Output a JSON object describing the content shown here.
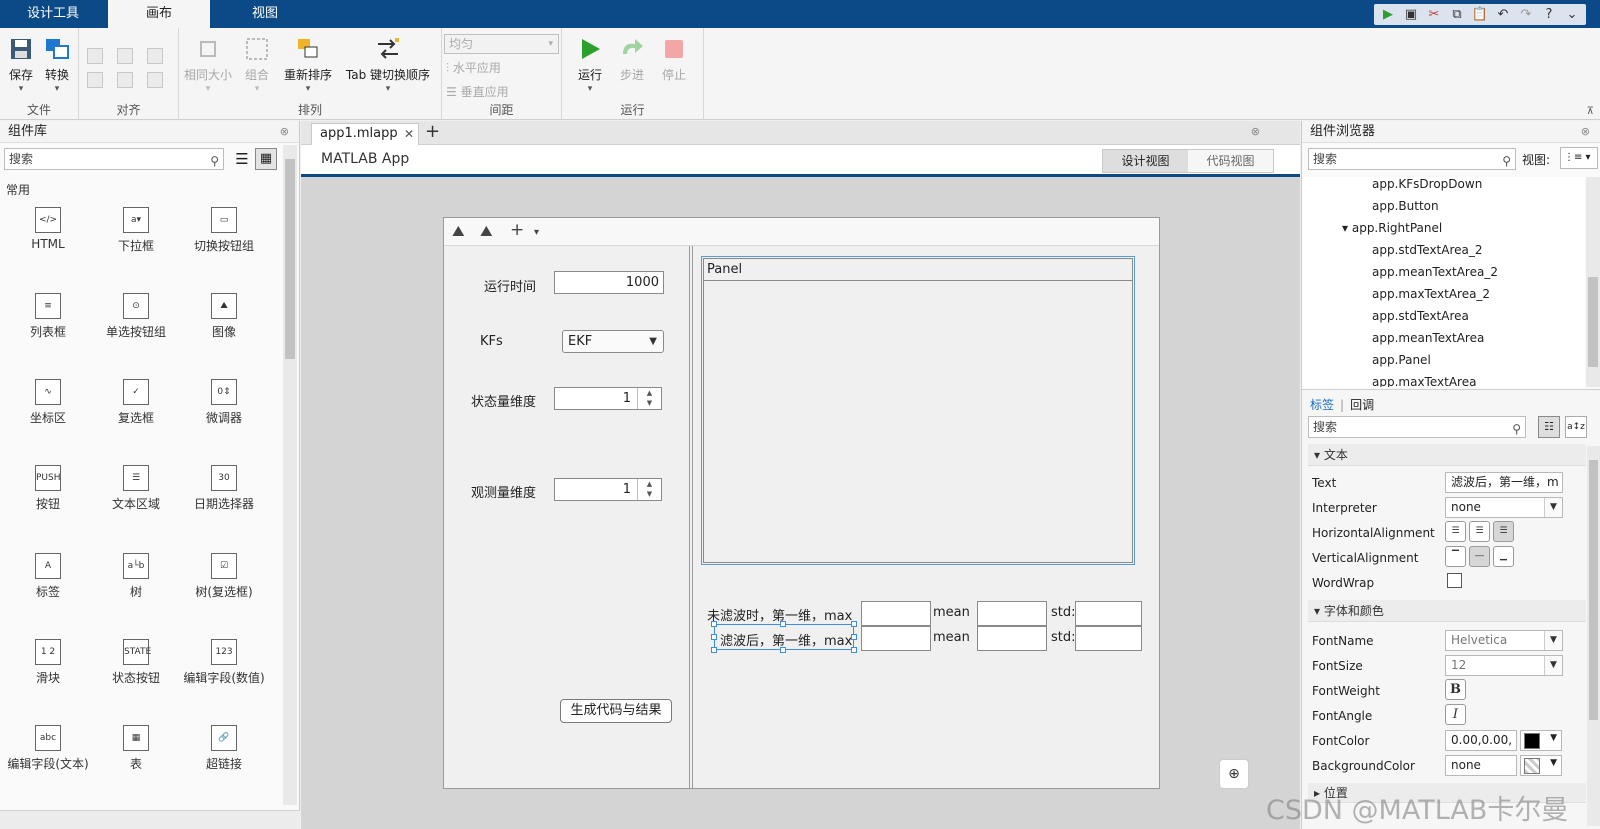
{
  "tabs": [
    {
      "label": "设计工具"
    },
    {
      "label": "画布"
    },
    {
      "label": "视图"
    }
  ],
  "ribbon": {
    "file": {
      "title": "文件",
      "save": "保存",
      "convert": "转换"
    },
    "align": {
      "title": "对齐"
    },
    "arrange": {
      "title": "排列",
      "same_size": "相同大小",
      "group": "组合",
      "reorder": "重新排序",
      "tab_order": "Tab 键切换顺序"
    },
    "spacing": {
      "title": "间距",
      "even": "均匀",
      "horiz": "水平应用",
      "vert": "垂直应用"
    },
    "run": {
      "title": "运行",
      "run": "运行",
      "step": "步进",
      "stop": "停止"
    }
  },
  "library": {
    "title": "组件库",
    "search_placeholder": "搜索",
    "section": "常用",
    "components": [
      {
        "label": "HTML",
        "icon": "html-icon",
        "glyph": "</>"
      },
      {
        "label": "下拉框",
        "icon": "dropdown-icon",
        "glyph": "a▾"
      },
      {
        "label": "切换按钮组",
        "icon": "toggle-button-group-icon",
        "glyph": "▭"
      },
      {
        "label": "列表框",
        "icon": "listbox-icon",
        "glyph": "≡"
      },
      {
        "label": "单选按钮组",
        "icon": "radio-group-icon",
        "glyph": "⊙"
      },
      {
        "label": "图像",
        "icon": "image-icon",
        "glyph": "⛰"
      },
      {
        "label": "坐标区",
        "icon": "axes-icon",
        "glyph": "∿"
      },
      {
        "label": "复选框",
        "icon": "checkbox-icon",
        "glyph": "✓"
      },
      {
        "label": "微调器",
        "icon": "spinner-icon",
        "glyph": "0⇕"
      },
      {
        "label": "按钮",
        "icon": "push-button-icon",
        "glyph": "PUSH"
      },
      {
        "label": "文本区域",
        "icon": "text-area-icon",
        "glyph": "☰"
      },
      {
        "label": "日期选择器",
        "icon": "date-picker-icon",
        "glyph": "30"
      },
      {
        "label": "标签",
        "icon": "label-icon",
        "glyph": "A"
      },
      {
        "label": "树",
        "icon": "tree-icon",
        "glyph": "a└b"
      },
      {
        "label": "树(复选框)",
        "icon": "checkbox-tree-icon",
        "glyph": "☑"
      },
      {
        "label": "滑块",
        "icon": "slider-icon",
        "glyph": "1 2"
      },
      {
        "label": "状态按钮",
        "icon": "state-button-icon",
        "glyph": "STATE"
      },
      {
        "label": "编辑字段(数值)",
        "icon": "numeric-field-icon",
        "glyph": "123"
      },
      {
        "label": "编辑字段(文本)",
        "icon": "text-field-icon",
        "glyph": "abc"
      },
      {
        "label": "表",
        "icon": "table-icon",
        "glyph": "▦"
      },
      {
        "label": "超链接",
        "icon": "hyperlink-icon",
        "glyph": "🔗"
      }
    ]
  },
  "document": {
    "tab": "app1.mlapp",
    "app_title": "MATLAB App",
    "design_view": "设计视图",
    "code_view": "代码视图"
  },
  "app": {
    "run_time_label": "运行时间",
    "run_time_value": "1000",
    "kfs_label": "KFs",
    "kfs_value": "EKF",
    "state_dim_label": "状态量维度",
    "state_dim_value": "1",
    "obs_dim_label": "观测量维度",
    "obs_dim_value": "1",
    "generate_button": "生成代码与结果",
    "panel_title": "Panel",
    "row1_label": "未滤波时，第一维，max",
    "row2_label": "滤波后，第一维，max",
    "mean_label": "mean",
    "std_label": "std:"
  },
  "browser": {
    "title": "组件浏览器",
    "search_placeholder": "搜索",
    "view_label": "视图:",
    "nodes": [
      "app.KFsDropDown",
      "app.Button",
      "app.RightPanel",
      "app.stdTextArea_2",
      "app.meanTextArea_2",
      "app.maxTextArea_2",
      "app.stdTextArea",
      "app.meanTextArea",
      "app.Panel",
      "app.maxTextArea"
    ]
  },
  "inspector": {
    "tab_props": "标签",
    "tab_callbacks": "回调",
    "search_placeholder": "搜索",
    "section_text": "文本",
    "section_font": "字体和颜色",
    "section_more": "位置",
    "text_label": "Text",
    "text_value": "滤波后，第一维，m",
    "interpreter_label": "Interpreter",
    "interpreter_value": "none",
    "halign_label": "HorizontalAlignment",
    "valign_label": "VerticalAlignment",
    "wordwrap_label": "WordWrap",
    "fontname_label": "FontName",
    "fontname_value": "Helvetica",
    "fontsize_label": "FontSize",
    "fontsize_value": "12",
    "fontweight_label": "FontWeight",
    "fontangle_label": "FontAngle",
    "fontcolor_label": "FontColor",
    "fontcolor_value": "0.00,0.00,",
    "bgcolor_label": "BackgroundColor",
    "bgcolor_value": "none"
  },
  "watermark": "CSDN @MATLAB卡尔曼",
  "colors": {
    "accent": "#0b4a86",
    "selection": "#3d8ee0",
    "run_green": "#2ca02c"
  }
}
